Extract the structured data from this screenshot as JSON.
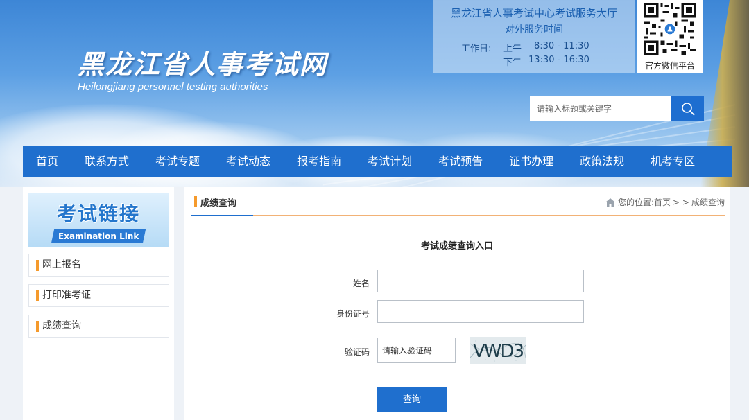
{
  "header": {
    "site_title": "黑龙江省人事考试网",
    "site_subtitle": "Heilongjiang personnel testing authorities",
    "service": {
      "title": "黑龙江省人事考试中心考试服务大厅",
      "hours_label": "对外服务时间",
      "workday_label": "工作日:",
      "morning_label": "上午",
      "morning_time": "8:30 - 11:30",
      "afternoon_label": "下午",
      "afternoon_time": "13:30 - 16:30"
    },
    "qr_label": "官方微信平台",
    "search": {
      "placeholder": "请输入标题或关键字",
      "icon": "search-icon"
    }
  },
  "nav": {
    "items": [
      {
        "label": "首页"
      },
      {
        "label": "联系方式"
      },
      {
        "label": "考试专题"
      },
      {
        "label": "考试动态"
      },
      {
        "label": "报考指南"
      },
      {
        "label": "考试计划"
      },
      {
        "label": "考试预告"
      },
      {
        "label": "证书办理"
      },
      {
        "label": "政策法规"
      },
      {
        "label": "机考专区"
      }
    ]
  },
  "sidebar": {
    "banner_title": "考试链接",
    "banner_en": "Examination Link",
    "items": [
      {
        "label": "网上报名"
      },
      {
        "label": "打印准考证"
      },
      {
        "label": "成绩查询"
      }
    ]
  },
  "main": {
    "title": "成绩查询",
    "breadcrumb": {
      "prefix": "您的位置:",
      "home": "首页",
      "separator": "> >",
      "current": "成绩查询"
    },
    "form": {
      "heading": "考试成绩查询入口",
      "name_label": "姓名",
      "name_value": "",
      "id_label": "身份证号",
      "id_value": "",
      "captcha_label": "验证码",
      "captcha_placeholder": "请输入验证码",
      "captcha_text": "VWD3",
      "submit_label": "查询"
    }
  },
  "colors": {
    "primary": "#1f6fce",
    "accent": "#f59a2c"
  }
}
